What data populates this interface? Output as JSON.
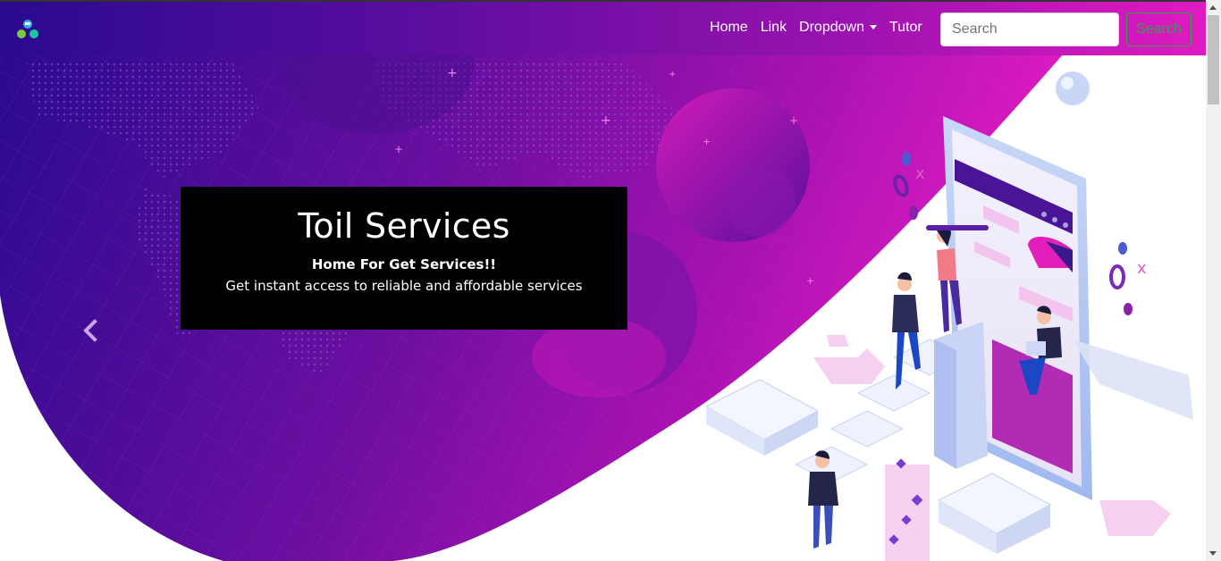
{
  "navbar": {
    "brand_icon": "cluster-logo-icon",
    "links": [
      {
        "label": "Home"
      },
      {
        "label": "Link"
      },
      {
        "label": "Dropdown"
      },
      {
        "label": "Tutor"
      }
    ],
    "search": {
      "placeholder": "Search",
      "button_label": "Search"
    },
    "colors": {
      "gradient_start": "#2a0a8f",
      "gradient_end": "#e01ac0",
      "search_button": "#28a745"
    }
  },
  "carousel": {
    "caption": {
      "title": "Toil Services",
      "subtitle": "Home For Get Services!!",
      "description": "Get instant access to reliable and affordable services"
    },
    "prev_icon": "chevron-left-icon"
  }
}
